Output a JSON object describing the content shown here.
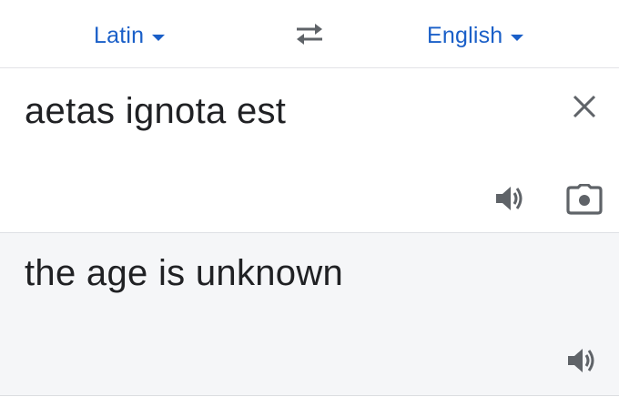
{
  "languages": {
    "source_label": "Latin",
    "target_label": "English",
    "source_dropdown_icon": "caret-down-icon",
    "target_dropdown_icon": "caret-down-icon",
    "swap_icon": "swap-arrows-icon"
  },
  "source": {
    "text": "aetas ignota est",
    "clear_icon": "close-icon",
    "speak_icon": "speaker-icon",
    "camera_icon": "camera-icon"
  },
  "result": {
    "text": "the age is unknown",
    "speak_icon": "speaker-icon"
  },
  "colors": {
    "accent": "#1a5fc8",
    "text": "#202124",
    "icon": "#5f6368",
    "result_background": "#f5f6f8",
    "divider": "#e2e3e6"
  }
}
